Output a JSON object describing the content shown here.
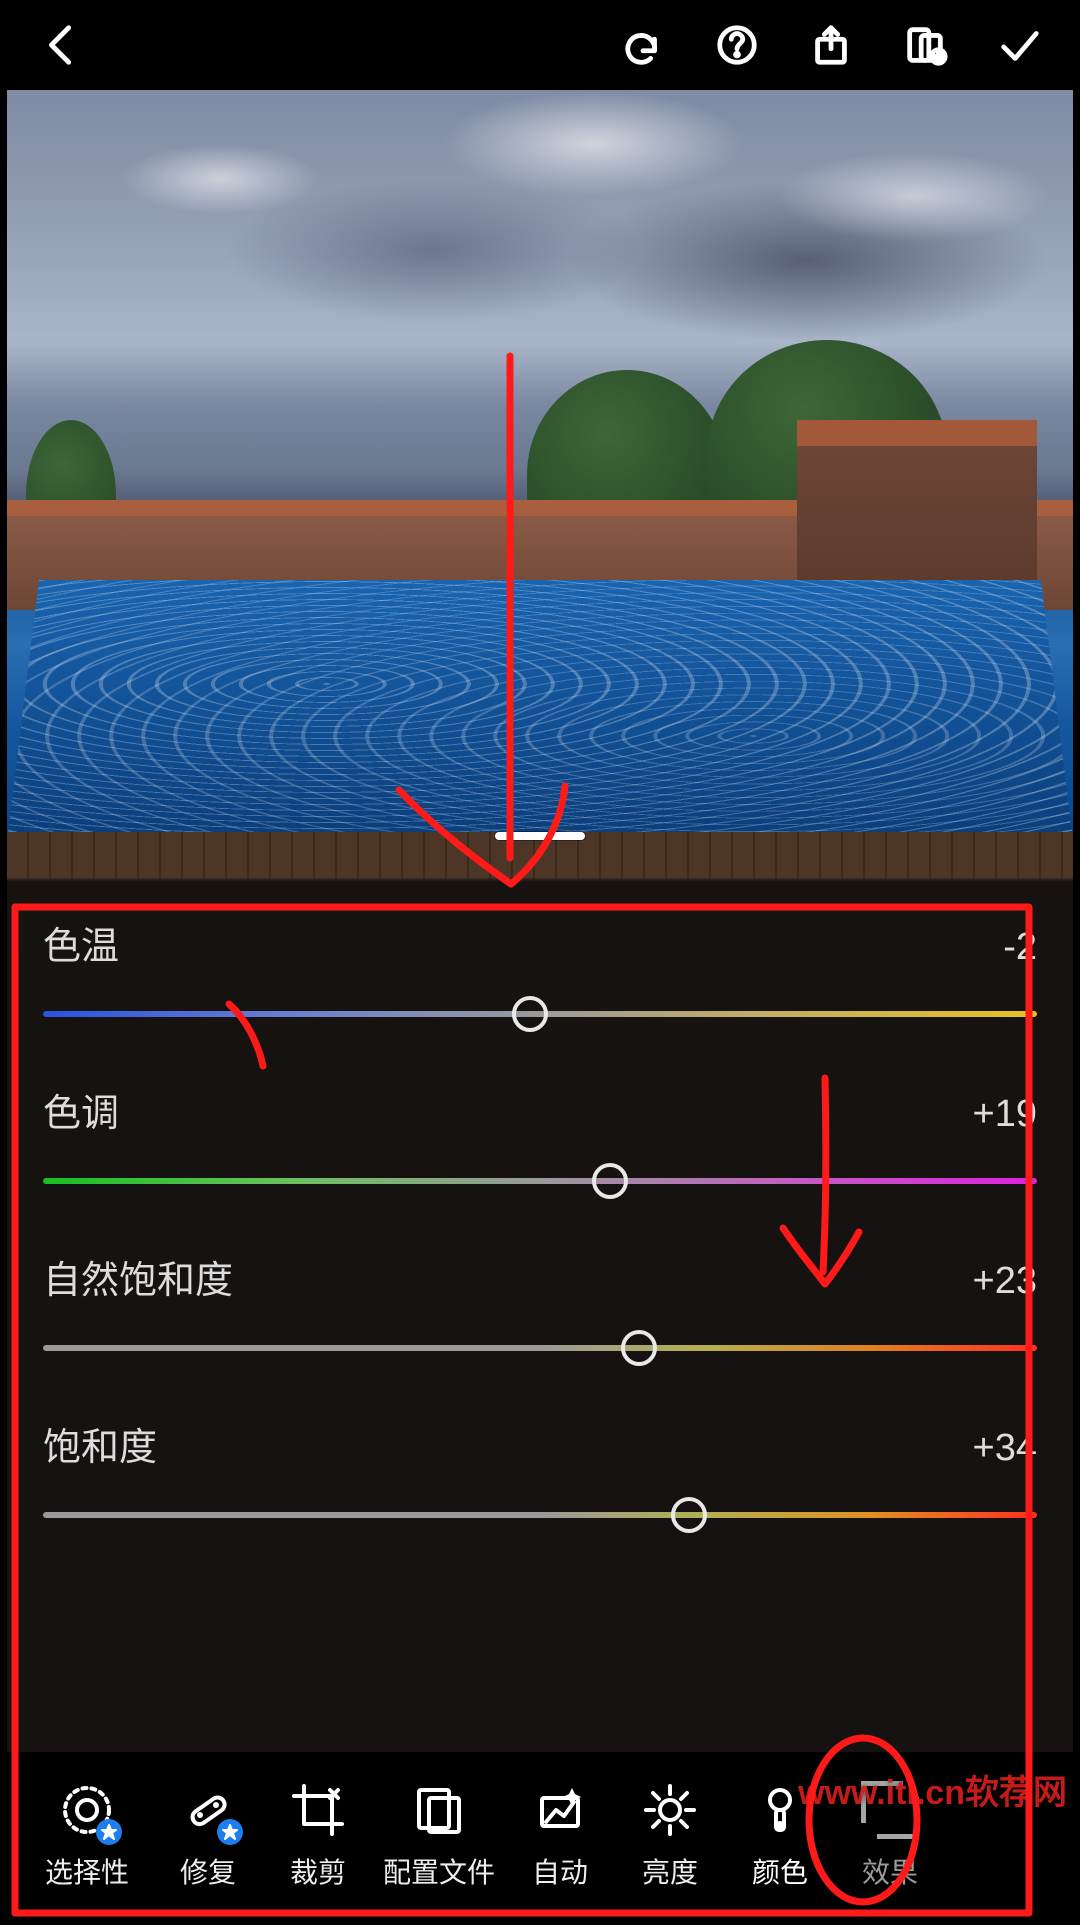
{
  "topbar": {
    "back": "back",
    "undo": "undo",
    "help": "help",
    "share": "share",
    "presets": "presets",
    "confirm": "confirm"
  },
  "sliders": {
    "temperature": {
      "label": "色温",
      "value": -2,
      "display": "-2",
      "thumb_pct": 49
    },
    "tint": {
      "label": "色调",
      "value": 19,
      "display": "+19",
      "thumb_pct": 57
    },
    "vibrance": {
      "label": "自然饱和度",
      "value": 23,
      "display": "+23",
      "thumb_pct": 60
    },
    "saturation": {
      "label": "饱和度",
      "value": 34,
      "display": "+34",
      "thumb_pct": 65
    }
  },
  "toolbar": {
    "selective": "选择性",
    "heal": "修复",
    "crop": "裁剪",
    "profiles": "配置文件",
    "auto": "自动",
    "light": "亮度",
    "color": "颜色",
    "effects": "效果"
  },
  "watermark": "www.iti.cn软荐网"
}
